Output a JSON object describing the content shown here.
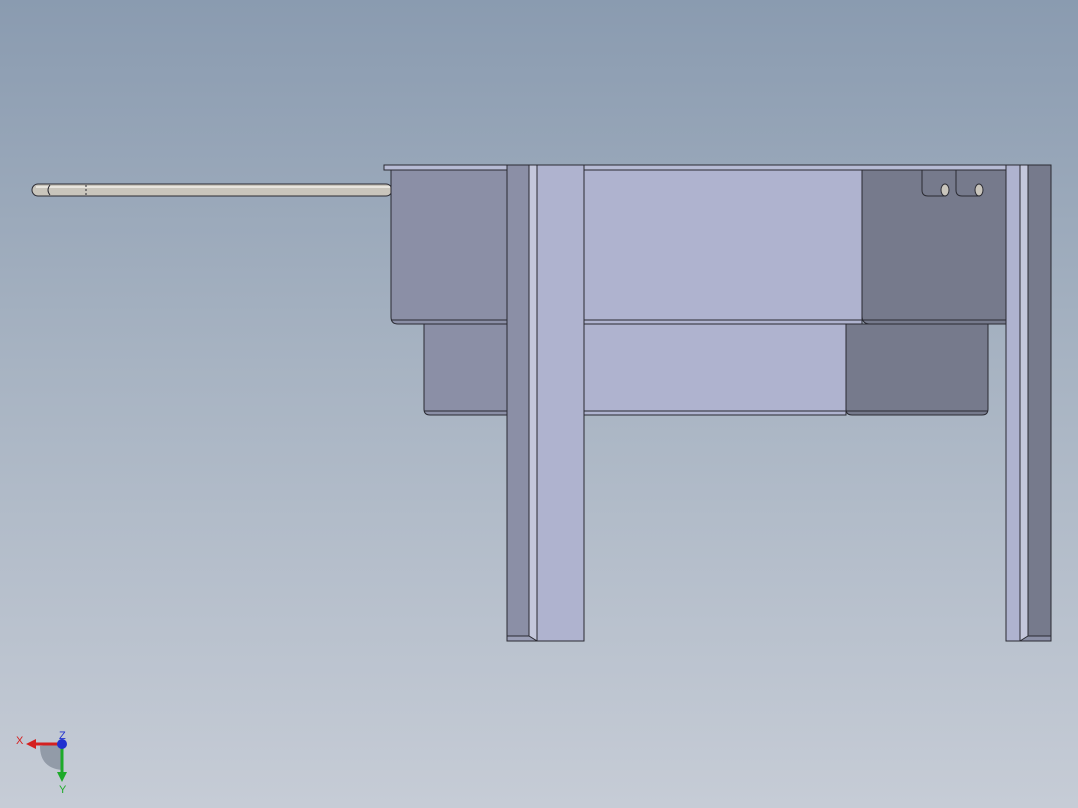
{
  "viewport": {
    "background_top": "#8a9bb0",
    "background_bottom": "#c6ccd6"
  },
  "triad": {
    "x_label": "X",
    "y_label": "Y",
    "z_label": "Z",
    "x_color": "#d42020",
    "y_color": "#1eaa2a",
    "z_color": "#2030d0"
  },
  "colors": {
    "light_face": "#afb3cf",
    "mid_face": "#8b8fa6",
    "dark_face": "#767a8c",
    "rod": "#c9c5bc",
    "edge": "#2a2a32"
  }
}
